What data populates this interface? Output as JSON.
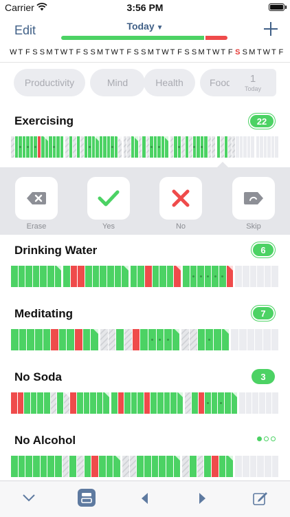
{
  "status": {
    "carrier": "Carrier",
    "time": "3:56 PM"
  },
  "nav": {
    "edit_label": "Edit",
    "title": "Today"
  },
  "days": [
    "W",
    "T",
    "F",
    "S",
    "S",
    "M",
    "T",
    "W",
    "T",
    "F",
    "S",
    "S",
    "M",
    "T",
    "W",
    "T",
    "F",
    "S",
    "S",
    "M",
    "T",
    "W",
    "T",
    "F",
    "S",
    "S",
    "M",
    "T",
    "W",
    "T",
    "F",
    "S",
    "S",
    "M",
    "T",
    "W",
    "T",
    "F"
  ],
  "highlight_day_index": 31,
  "categories": [
    "Productivity",
    "Mind",
    "Health",
    "Food"
  ],
  "today_box": {
    "count": "1",
    "label": "Today"
  },
  "actions": [
    {
      "label": "Erase"
    },
    {
      "label": "Yes"
    },
    {
      "label": "No"
    },
    {
      "label": "Skip"
    }
  ],
  "habits": [
    {
      "name": "Exercising",
      "count": "22"
    },
    {
      "name": "Drinking Water",
      "count": "6"
    },
    {
      "name": "Meditating",
      "count": "7"
    },
    {
      "name": "No Soda",
      "count": "3"
    },
    {
      "name": "No Alcohol",
      "count": ""
    }
  ],
  "colors": {
    "green": "#4cd264",
    "red": "#ef4b4b",
    "accent": "#3f5f86",
    "skip": "#d0d2d6"
  }
}
